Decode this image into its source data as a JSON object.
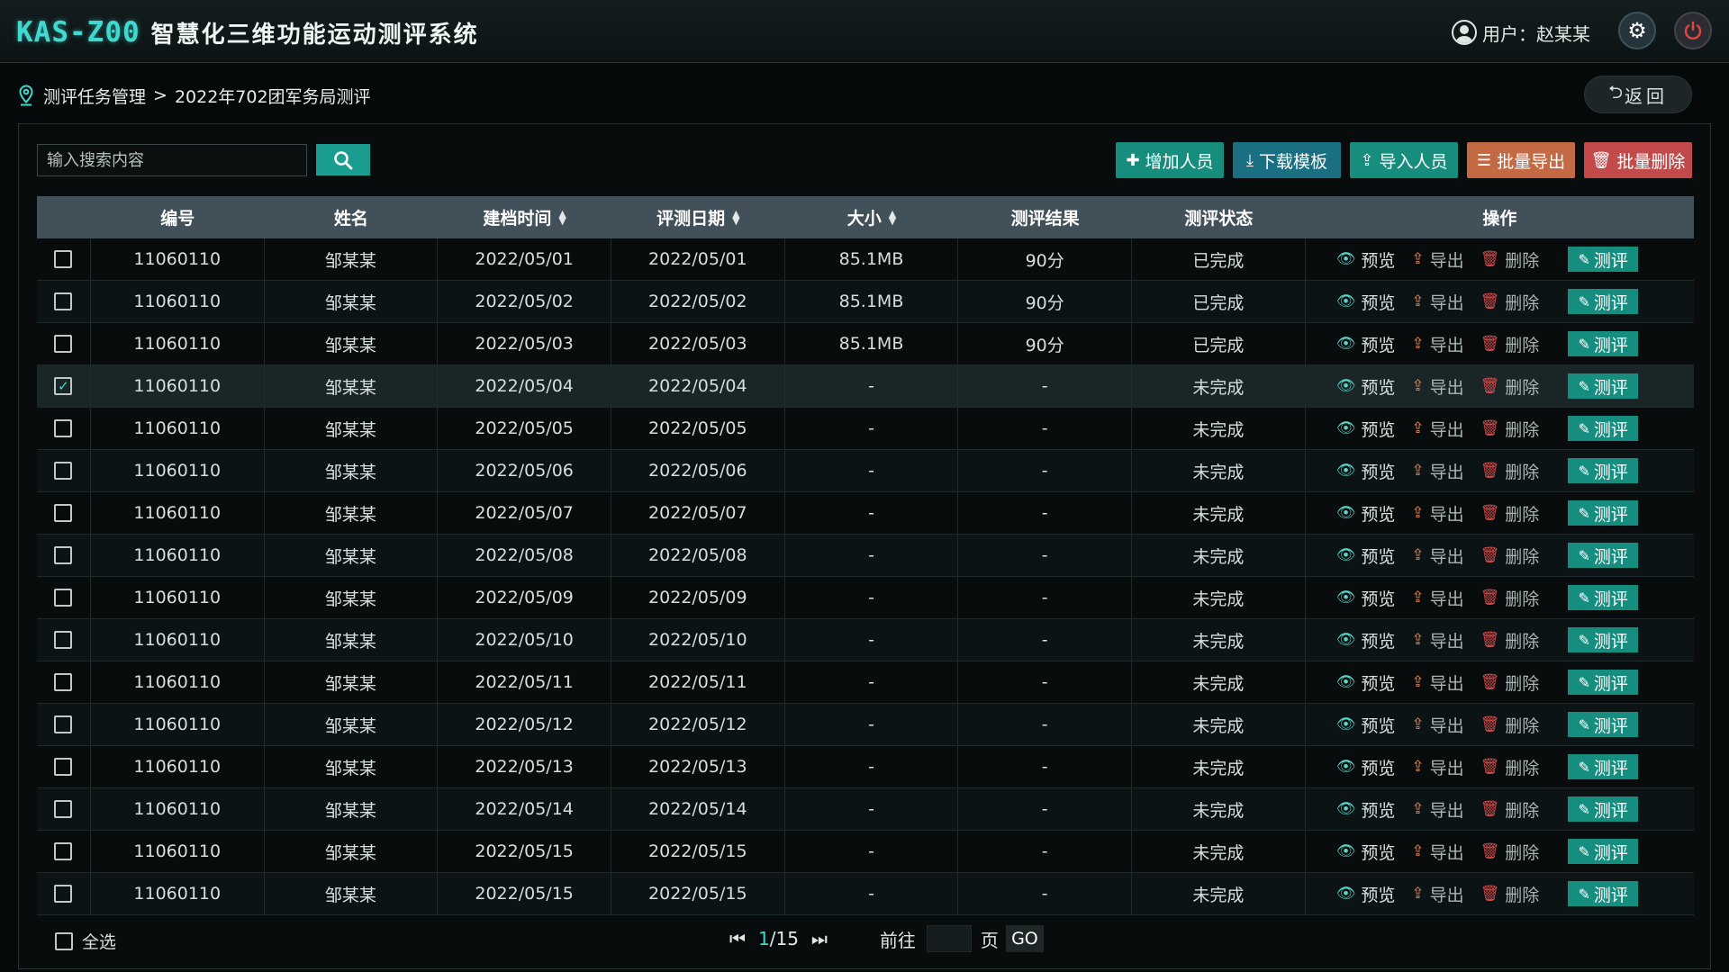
{
  "header": {
    "logo_code": "KAS-Z00",
    "logo_title": "智慧化三维功能运动测评系统",
    "user_label": "用户：",
    "user_name": "赵某某"
  },
  "breadcrumb": {
    "root": "测评任务管理",
    "sep": ">",
    "current": "2022年702团军务局测评",
    "back_label": "返回"
  },
  "toolbar": {
    "search_placeholder": "输入搜索内容",
    "add": "增加人员",
    "download": "下载模板",
    "import": "导入人员",
    "batch_export": "批量导出",
    "batch_delete": "批量删除"
  },
  "table": {
    "headers": [
      "编号",
      "姓名",
      "建档时间",
      "评测日期",
      "大小",
      "测评结果",
      "测评状态",
      "操作"
    ],
    "actions": {
      "view": "预览",
      "export": "导出",
      "delete": "删除",
      "evaluate": "测评"
    },
    "rows": [
      {
        "id": "11060110",
        "name": "邹某某",
        "created": "2022/05/01",
        "eval_date": "2022/05/01",
        "size": "85.1MB",
        "result": "90分",
        "status": "已完成",
        "checked": false
      },
      {
        "id": "11060110",
        "name": "邹某某",
        "created": "2022/05/02",
        "eval_date": "2022/05/02",
        "size": "85.1MB",
        "result": "90分",
        "status": "已完成",
        "checked": false
      },
      {
        "id": "11060110",
        "name": "邹某某",
        "created": "2022/05/03",
        "eval_date": "2022/05/03",
        "size": "85.1MB",
        "result": "90分",
        "status": "已完成",
        "checked": false
      },
      {
        "id": "11060110",
        "name": "邹某某",
        "created": "2022/05/04",
        "eval_date": "2022/05/04",
        "size": "-",
        "result": "-",
        "status": "未完成",
        "checked": true
      },
      {
        "id": "11060110",
        "name": "邹某某",
        "created": "2022/05/05",
        "eval_date": "2022/05/05",
        "size": "-",
        "result": "-",
        "status": "未完成",
        "checked": false
      },
      {
        "id": "11060110",
        "name": "邹某某",
        "created": "2022/05/06",
        "eval_date": "2022/05/06",
        "size": "-",
        "result": "-",
        "status": "未完成",
        "checked": false
      },
      {
        "id": "11060110",
        "name": "邹某某",
        "created": "2022/05/07",
        "eval_date": "2022/05/07",
        "size": "-",
        "result": "-",
        "status": "未完成",
        "checked": false
      },
      {
        "id": "11060110",
        "name": "邹某某",
        "created": "2022/05/08",
        "eval_date": "2022/05/08",
        "size": "-",
        "result": "-",
        "status": "未完成",
        "checked": false
      },
      {
        "id": "11060110",
        "name": "邹某某",
        "created": "2022/05/09",
        "eval_date": "2022/05/09",
        "size": "-",
        "result": "-",
        "status": "未完成",
        "checked": false
      },
      {
        "id": "11060110",
        "name": "邹某某",
        "created": "2022/05/10",
        "eval_date": "2022/05/10",
        "size": "-",
        "result": "-",
        "status": "未完成",
        "checked": false
      },
      {
        "id": "11060110",
        "name": "邹某某",
        "created": "2022/05/11",
        "eval_date": "2022/05/11",
        "size": "-",
        "result": "-",
        "status": "未完成",
        "checked": false
      },
      {
        "id": "11060110",
        "name": "邹某某",
        "created": "2022/05/12",
        "eval_date": "2022/05/12",
        "size": "-",
        "result": "-",
        "status": "未完成",
        "checked": false
      },
      {
        "id": "11060110",
        "name": "邹某某",
        "created": "2022/05/13",
        "eval_date": "2022/05/13",
        "size": "-",
        "result": "-",
        "status": "未完成",
        "checked": false
      },
      {
        "id": "11060110",
        "name": "邹某某",
        "created": "2022/05/14",
        "eval_date": "2022/05/14",
        "size": "-",
        "result": "-",
        "status": "未完成",
        "checked": false
      },
      {
        "id": "11060110",
        "name": "邹某某",
        "created": "2022/05/15",
        "eval_date": "2022/05/15",
        "size": "-",
        "result": "-",
        "status": "未完成",
        "checked": false
      },
      {
        "id": "11060110",
        "name": "邹某某",
        "created": "2022/05/15",
        "eval_date": "2022/05/15",
        "size": "-",
        "result": "-",
        "status": "未完成",
        "checked": false
      }
    ]
  },
  "footer": {
    "select_all": "全选",
    "page_current": "1",
    "page_total": "/15",
    "goto_label": "前往",
    "page_word": "页",
    "go_label": "GO"
  },
  "colors": {
    "accent": "#3fd9d0",
    "primary_button": "#178d7e",
    "download_button": "#1b6f82",
    "export_button": "#c36a45",
    "delete_button": "#c24a4a",
    "table_header": "#42505a"
  }
}
